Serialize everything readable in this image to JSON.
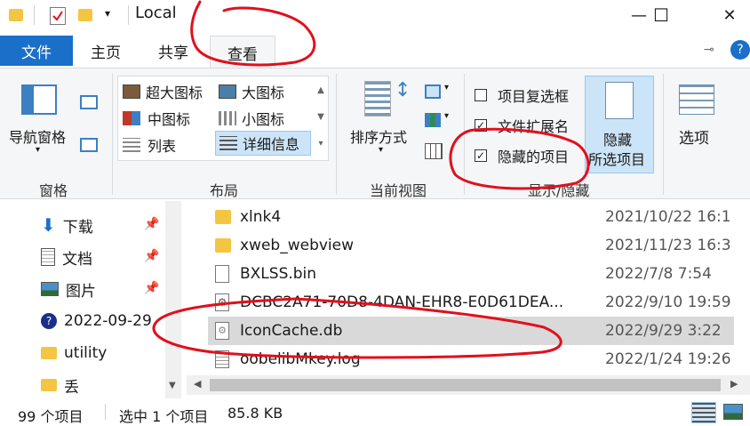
{
  "window": {
    "title": "Local",
    "minimize_glyph": "—",
    "maximize_glyph": "☐",
    "close_glyph": "✕"
  },
  "tabs": [
    {
      "label": "文件"
    },
    {
      "label": "主页"
    },
    {
      "label": "共享"
    },
    {
      "label": "查看"
    }
  ],
  "ribbon": {
    "panes": {
      "label": "导航窗格",
      "group": "窗格"
    },
    "layout": {
      "group": "布局",
      "items": [
        "超大图标",
        "大图标",
        "中图标",
        "小图标",
        "列表",
        "详细信息"
      ]
    },
    "current_view": {
      "sort_label": "排序方式",
      "group": "当前视图"
    },
    "show_hide": {
      "group": "显示/隐藏",
      "item_checkboxes": "项目复选框",
      "file_extensions": "文件扩展名",
      "hidden_items": "隐藏的项目",
      "hide_selected_line1": "隐藏",
      "hide_selected_line2": "所选项目"
    },
    "options": "选项"
  },
  "nav": [
    {
      "label": "下载",
      "icon": "download-arrow-icon"
    },
    {
      "label": "文档",
      "icon": "document-icon"
    },
    {
      "label": "图片",
      "icon": "pictures-icon"
    },
    {
      "label": "2022-09-29",
      "icon": "help-icon"
    },
    {
      "label": "utility",
      "icon": "folder-icon"
    },
    {
      "label": "丢",
      "icon": "folder-icon"
    }
  ],
  "files": [
    {
      "name": "xlnk4",
      "date": "2021/10/22 16:1",
      "icon": "folder-icon"
    },
    {
      "name": "xweb_webview",
      "date": "2021/11/23 16:3",
      "icon": "folder-icon"
    },
    {
      "name": "BXLSS.bin",
      "date": "2022/7/8 7:54",
      "icon": "file-icon"
    },
    {
      "name": "DCBC2A71-70D8-4DAN-EHR8-E0D61DEA...",
      "date": "2022/9/10 19:59",
      "icon": "settings-file-icon"
    },
    {
      "name": "IconCache.db",
      "date": "2022/9/29 3:22",
      "icon": "db-file-icon",
      "selected": true
    },
    {
      "name": "oobelibMkey.log",
      "date": "2022/1/24 19:26",
      "icon": "text-file-icon"
    }
  ],
  "status": {
    "item_count": "99 个项目",
    "selection": "选中 1 个项目",
    "size": "85.8 KB"
  },
  "colors": {
    "accent": "#1a6fc9",
    "annotation": "#e0101e",
    "folder": "#f4c542"
  }
}
